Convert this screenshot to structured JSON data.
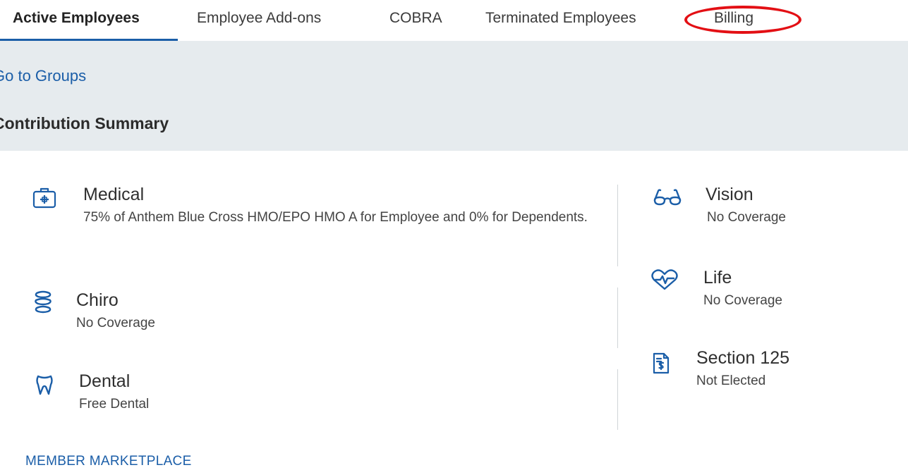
{
  "tabs": [
    {
      "label": "Active Employees",
      "active": true
    },
    {
      "label": "Employee Add-ons"
    },
    {
      "label": "COBRA"
    },
    {
      "label": "Terminated Employees"
    },
    {
      "label": "Billing"
    }
  ],
  "header": {
    "go_to_groups": "Go to Groups",
    "title": "Contribution Summary"
  },
  "coverage": {
    "medical": {
      "name": "Medical",
      "icon": "medical-kit-icon",
      "desc": "75% of Anthem Blue Cross HMO/EPO HMO A for Employee and 0% for Dependents."
    },
    "chiro": {
      "name": "Chiro",
      "icon": "spine-icon",
      "desc": "No Coverage"
    },
    "dental": {
      "name": "Dental",
      "icon": "tooth-icon",
      "desc": "Free Dental"
    },
    "vision": {
      "name": "Vision",
      "icon": "glasses-icon",
      "desc": "No Coverage"
    },
    "life": {
      "name": "Life",
      "icon": "heartbeat-icon",
      "desc": "No Coverage"
    },
    "section125": {
      "name": "Section 125",
      "icon": "dollar-document-icon",
      "desc": "Not Elected"
    }
  },
  "footer": {
    "marketplace": "MEMBER MARKETPLACE"
  },
  "colors": {
    "accent": "#1b5ea8",
    "band": "#e6ebee",
    "highlight": "#e30f14"
  }
}
